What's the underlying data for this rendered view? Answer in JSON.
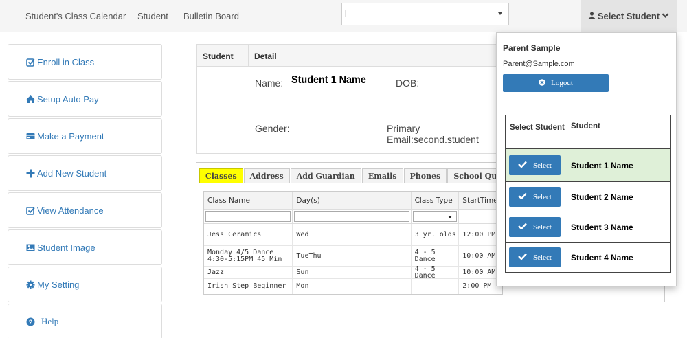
{
  "topnav": {
    "links": [
      "Student's Class Calendar",
      "Student",
      "Bulletin Board"
    ],
    "select_student_label": "Select Student",
    "dropdown_value": ""
  },
  "sidebar": {
    "items": [
      {
        "label": "Enroll in Class",
        "icon": "check-square-icon"
      },
      {
        "label": "Setup Auto Pay",
        "icon": "home-icon"
      },
      {
        "label": "Make a Payment",
        "icon": "credit-card-icon"
      },
      {
        "label": "Add New Student",
        "icon": "plus-icon"
      },
      {
        "label": "View Attendance",
        "icon": "check-square-icon"
      },
      {
        "label": "Student Image",
        "icon": "picture-icon"
      },
      {
        "label": "My Setting",
        "icon": "gear-icon"
      },
      {
        "label": "Help",
        "icon": "question-circle-icon"
      }
    ]
  },
  "student_panel": {
    "headers": [
      "Student",
      "Detail"
    ],
    "name_label": "Name:",
    "name_value": "Student 1 Name",
    "dob_label": "DOB:",
    "gender_label": "Gender:",
    "primary_email_label": "Primary",
    "primary_email_value": "Email:second.student"
  },
  "tabs": [
    "Classes",
    "Address",
    "Add Guardian",
    "Emails",
    "Phones",
    "School Questic"
  ],
  "classes_grid": {
    "columns": [
      "Class Name",
      "Day(s)",
      "Class Type",
      "StartTime"
    ],
    "rows": [
      [
        "Jess Ceramics",
        "Wed",
        "3 yr. olds",
        "12:00 PM"
      ],
      [
        "Monday 4/5 Dance 4:30-5:15PM 45 Min",
        "TueThu",
        "4 - 5 Dance",
        "10:00 AM"
      ],
      [
        "Jazz",
        "Sun",
        "4 - 5 Dance",
        "10:00 AM"
      ],
      [
        "Irish Step Beginner",
        "Mon",
        "",
        "2:00 PM"
      ]
    ]
  },
  "dropdown": {
    "parent_name": "Parent Sample",
    "parent_email": "Parent@Sample.com",
    "logout_label": "Logout",
    "table_headers": [
      "Select Student",
      "Student"
    ],
    "select_label": "Select",
    "students": [
      "Student 1 Name",
      "Student 2 Name",
      "Student 3 Name",
      "Student 4 Name"
    ],
    "selected_row_color": "#dff0d8",
    "button_color": "#337ab7"
  }
}
